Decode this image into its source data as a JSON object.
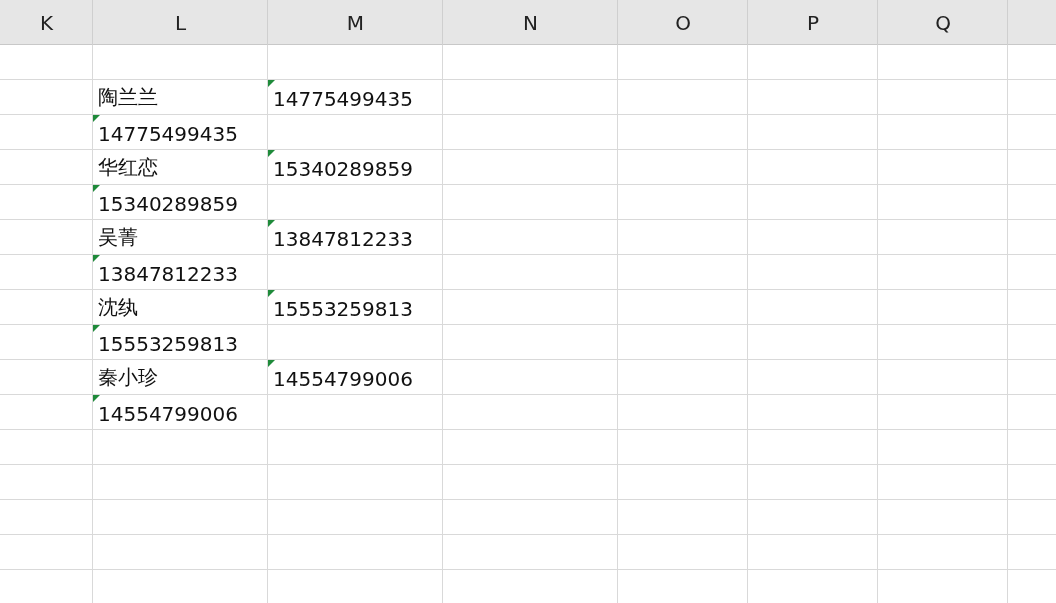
{
  "columns": [
    "K",
    "L",
    "M",
    "N",
    "O",
    "P",
    "Q"
  ],
  "rows": [
    {
      "column_l": {
        "text": "陶兰兰",
        "warning": false
      },
      "column_m": {
        "text": "14775499435",
        "warning": true
      }
    },
    {
      "column_l": {
        "text": "14775499435",
        "warning": true
      }
    },
    {
      "column_l": {
        "text": "华红恋",
        "warning": false
      },
      "column_m": {
        "text": "15340289859",
        "warning": true
      }
    },
    {
      "column_l": {
        "text": "15340289859",
        "warning": true
      }
    },
    {
      "column_l": {
        "text": "吴菁",
        "warning": false
      },
      "column_m": {
        "text": "13847812233",
        "warning": true
      }
    },
    {
      "column_l": {
        "text": "13847812233",
        "warning": true
      }
    },
    {
      "column_l": {
        "text": "沈纨",
        "warning": false
      },
      "column_m": {
        "text": "15553259813",
        "warning": true
      }
    },
    {
      "column_l": {
        "text": "15553259813",
        "warning": true
      }
    },
    {
      "column_l": {
        "text": "秦小珍",
        "warning": false
      },
      "column_m": {
        "text": "14554799006",
        "warning": true
      }
    },
    {
      "column_l": {
        "text": "14554799006",
        "warning": true
      }
    }
  ]
}
